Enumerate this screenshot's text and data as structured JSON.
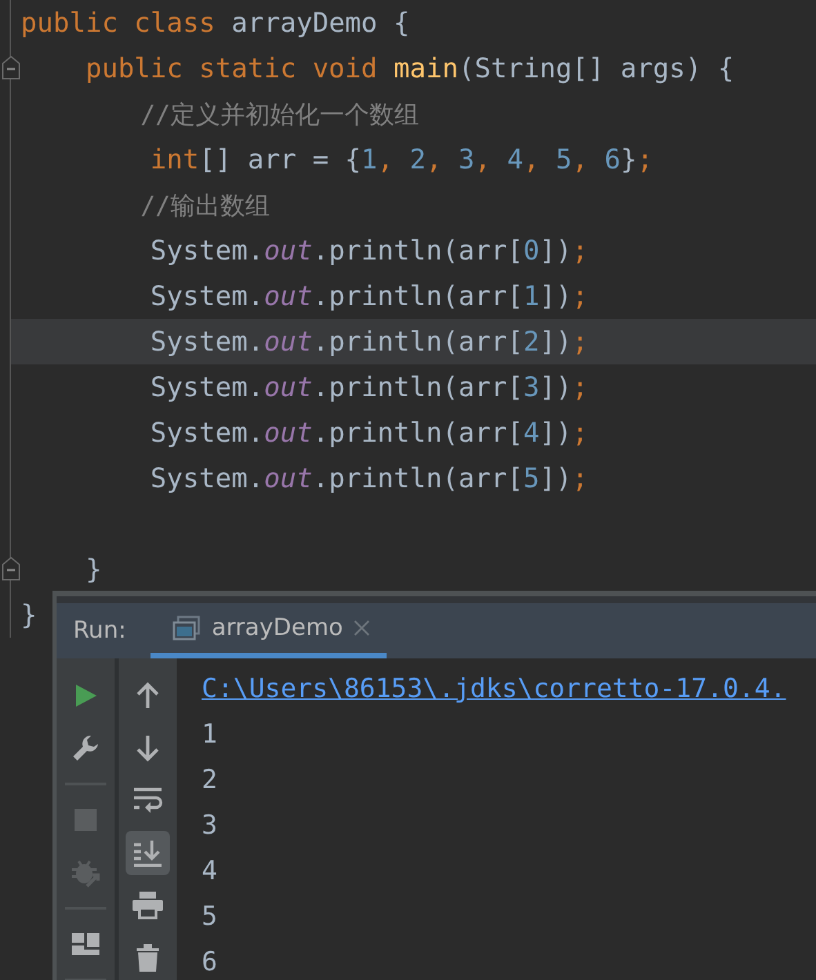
{
  "editor": {
    "lines": [
      {
        "fold": false,
        "current": false,
        "tokens": [
          {
            "kind": "kw",
            "text": "public class "
          },
          {
            "kind": "plain",
            "text": "arrayDemo {"
          }
        ]
      },
      {
        "fold": true,
        "current": false,
        "tokens": [
          {
            "kind": "kw",
            "text": "    public static void "
          },
          {
            "kind": "method",
            "text": "main"
          },
          {
            "kind": "plain",
            "text": "(String[] args) {"
          }
        ]
      },
      {
        "fold": false,
        "current": false,
        "tokens": [
          {
            "kind": "comment",
            "text": "        //定义并初始化一个数组"
          }
        ]
      },
      {
        "fold": false,
        "current": false,
        "tokens": [
          {
            "kind": "kw",
            "text": "        int"
          },
          {
            "kind": "plain",
            "text": "[] arr = {"
          },
          {
            "kind": "num",
            "text": "1"
          },
          {
            "kind": "kw",
            "text": ", "
          },
          {
            "kind": "num",
            "text": "2"
          },
          {
            "kind": "kw",
            "text": ", "
          },
          {
            "kind": "num",
            "text": "3"
          },
          {
            "kind": "kw",
            "text": ", "
          },
          {
            "kind": "num",
            "text": "4"
          },
          {
            "kind": "kw",
            "text": ", "
          },
          {
            "kind": "num",
            "text": "5"
          },
          {
            "kind": "kw",
            "text": ", "
          },
          {
            "kind": "num",
            "text": "6"
          },
          {
            "kind": "plain",
            "text": "}"
          },
          {
            "kind": "kw",
            "text": ";"
          }
        ]
      },
      {
        "fold": false,
        "current": false,
        "tokens": [
          {
            "kind": "comment",
            "text": "        //输出数组"
          }
        ]
      },
      {
        "fold": false,
        "current": false,
        "tokens": [
          {
            "kind": "plain",
            "text": "        System."
          },
          {
            "kind": "field",
            "text": "out"
          },
          {
            "kind": "plain",
            "text": ".println(arr["
          },
          {
            "kind": "num",
            "text": "0"
          },
          {
            "kind": "plain",
            "text": "])"
          },
          {
            "kind": "kw",
            "text": ";"
          }
        ]
      },
      {
        "fold": false,
        "current": false,
        "tokens": [
          {
            "kind": "plain",
            "text": "        System."
          },
          {
            "kind": "field",
            "text": "out"
          },
          {
            "kind": "plain",
            "text": ".println(arr["
          },
          {
            "kind": "num",
            "text": "1"
          },
          {
            "kind": "plain",
            "text": "])"
          },
          {
            "kind": "kw",
            "text": ";"
          }
        ]
      },
      {
        "fold": false,
        "current": true,
        "tokens": [
          {
            "kind": "plain",
            "text": "        System."
          },
          {
            "kind": "field",
            "text": "out"
          },
          {
            "kind": "plain",
            "text": ".println(arr["
          },
          {
            "kind": "num",
            "text": "2"
          },
          {
            "kind": "plain",
            "text": "])"
          },
          {
            "kind": "kw",
            "text": ";"
          }
        ]
      },
      {
        "fold": false,
        "current": false,
        "tokens": [
          {
            "kind": "plain",
            "text": "        System."
          },
          {
            "kind": "field",
            "text": "out"
          },
          {
            "kind": "plain",
            "text": ".println(arr["
          },
          {
            "kind": "num",
            "text": "3"
          },
          {
            "kind": "plain",
            "text": "])"
          },
          {
            "kind": "kw",
            "text": ";"
          }
        ]
      },
      {
        "fold": false,
        "current": false,
        "tokens": [
          {
            "kind": "plain",
            "text": "        System."
          },
          {
            "kind": "field",
            "text": "out"
          },
          {
            "kind": "plain",
            "text": ".println(arr["
          },
          {
            "kind": "num",
            "text": "4"
          },
          {
            "kind": "plain",
            "text": "])"
          },
          {
            "kind": "kw",
            "text": ";"
          }
        ]
      },
      {
        "fold": false,
        "current": false,
        "tokens": [
          {
            "kind": "plain",
            "text": "        System."
          },
          {
            "kind": "field",
            "text": "out"
          },
          {
            "kind": "plain",
            "text": ".println(arr["
          },
          {
            "kind": "num",
            "text": "5"
          },
          {
            "kind": "plain",
            "text": "])"
          },
          {
            "kind": "kw",
            "text": ";"
          }
        ]
      },
      {
        "fold": false,
        "current": false
      },
      {
        "fold": true,
        "current": false,
        "tokens": [
          {
            "kind": "plain",
            "text": "    }"
          }
        ]
      },
      {
        "fold": false,
        "current": false,
        "tokens": [
          {
            "kind": "plain",
            "text": "}"
          }
        ]
      }
    ]
  },
  "run_panel": {
    "label": "Run:",
    "tabs": [
      {
        "label": "arrayDemo",
        "selected": true,
        "closable": true
      }
    ],
    "left_toolbar": [
      [
        {
          "kind": "run",
          "disabled": false
        },
        {
          "kind": "wrench",
          "disabled": false
        }
      ],
      [
        {
          "kind": "stop",
          "disabled": true
        },
        {
          "kind": "debug",
          "disabled": true
        }
      ],
      [
        {
          "kind": "layout",
          "disabled": false
        }
      ]
    ],
    "right_toolbar": [
      {
        "kind": "up",
        "on": false
      },
      {
        "kind": "down",
        "on": false
      },
      {
        "kind": "wrap",
        "on": false
      },
      {
        "kind": "scroll-end",
        "on": true
      },
      {
        "kind": "print",
        "on": false
      },
      {
        "kind": "trash",
        "on": false
      }
    ],
    "console": [
      {
        "kind": "link",
        "text": "C:\\Users\\86153\\.jdks\\corretto-17.0.4."
      },
      {
        "kind": "plain",
        "text": "1"
      },
      {
        "kind": "plain",
        "text": "2"
      },
      {
        "kind": "plain",
        "text": "3"
      },
      {
        "kind": "plain",
        "text": "4"
      },
      {
        "kind": "plain",
        "text": "5"
      },
      {
        "kind": "plain",
        "text": "6"
      }
    ]
  }
}
